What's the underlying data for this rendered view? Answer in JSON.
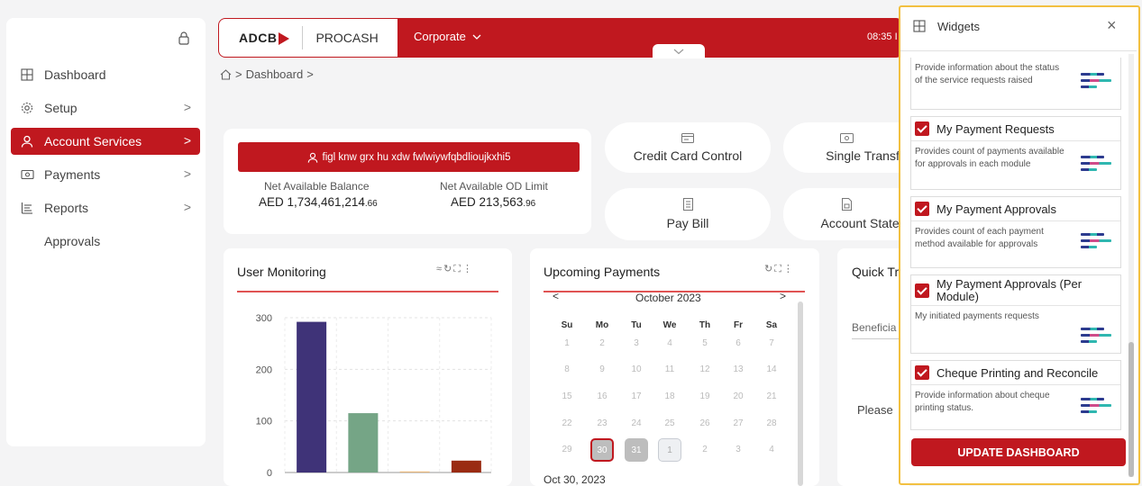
{
  "sidebar": {
    "items": [
      {
        "label": "Dashboard",
        "icon": "grid-icon",
        "chevron": ""
      },
      {
        "label": "Setup",
        "icon": "gear-icon",
        "chevron": ">"
      },
      {
        "label": "Account Services",
        "icon": "user-icon",
        "chevron": ">",
        "active": true
      },
      {
        "label": "Payments",
        "icon": "money-icon",
        "chevron": ">"
      },
      {
        "label": "Reports",
        "icon": "list-icon",
        "chevron": ">"
      },
      {
        "label": "Approvals",
        "icon": "",
        "chevron": ""
      }
    ]
  },
  "header": {
    "logo_text": "ADCB",
    "product": "PROCASH",
    "segment": "Corporate",
    "time": "08:35 I"
  },
  "breadcrumb": {
    "current": "Dashboard",
    "sep": ">"
  },
  "account": {
    "name": "figl knw grx hu xdw fwlwiywfqbdlioujkxhi5",
    "net_balance_label": "Net Available Balance",
    "net_balance_main": "AED 1,734,461,214",
    "net_balance_dec": ".66",
    "od_label": "Net Available OD Limit",
    "od_main": "AED 213,563",
    "od_dec": ".96"
  },
  "tiles": [
    {
      "label": "Credit Card Control",
      "icon": "card-icon"
    },
    {
      "label": "Single Transf",
      "icon": "money-icon"
    },
    {
      "label": "Pay Bill",
      "icon": "receipt-icon"
    },
    {
      "label": "Account Staten",
      "icon": "document-icon"
    }
  ],
  "user_monitoring": {
    "title": "User Monitoring"
  },
  "chart_data": {
    "type": "bar",
    "categories": [
      "",
      "",
      "",
      ""
    ],
    "values": [
      292,
      115,
      2,
      23
    ],
    "colors": [
      "#3f3378",
      "#75a586",
      "#e8b77a",
      "#9a2b12"
    ],
    "title": "User Monitoring",
    "xlabel": "",
    "ylabel": "",
    "yticks": [
      "300",
      "200",
      "100",
      "0"
    ],
    "ylim": [
      0,
      300
    ],
    "grid": true
  },
  "upcoming": {
    "title": "Upcoming Payments",
    "month": "October  2023",
    "prev": "<",
    "next": ">",
    "dow": [
      "Su",
      "Mo",
      "Tu",
      "We",
      "Th",
      "Fr",
      "Sa"
    ],
    "weeks": [
      [
        "1",
        "2",
        "3",
        "4",
        "5",
        "6",
        "7"
      ],
      [
        "8",
        "9",
        "10",
        "11",
        "12",
        "13",
        "14"
      ],
      [
        "15",
        "16",
        "17",
        "18",
        "19",
        "20",
        "21"
      ],
      [
        "22",
        "23",
        "24",
        "25",
        "26",
        "27",
        "28"
      ],
      [
        "29",
        "30",
        "31",
        "1",
        "2",
        "3",
        "4"
      ]
    ],
    "selected_date": "Oct 30, 2023"
  },
  "quick": {
    "title": "Quick Tr",
    "field": "Beneficia",
    "message": "Please"
  },
  "widgets": {
    "title": "Widgets",
    "close": "×",
    "top_desc": "Provide information about the status of the service requests raised",
    "cards": [
      {
        "title": "My Payment Requests",
        "desc": "Provides count of payments available for approvals in each module"
      },
      {
        "title": "My Payment Approvals",
        "desc": "Provides count of each payment method available for approvals"
      },
      {
        "title": "My Payment Approvals (Per Module)",
        "desc": "My initiated payments requests"
      },
      {
        "title": "Cheque Printing and Reconcile",
        "desc": "Provide information about cheque printing status."
      }
    ],
    "update_label": "UPDATE DASHBOARD"
  },
  "colors": {
    "brand": "#c0181f",
    "highlight": "#f2c040"
  }
}
